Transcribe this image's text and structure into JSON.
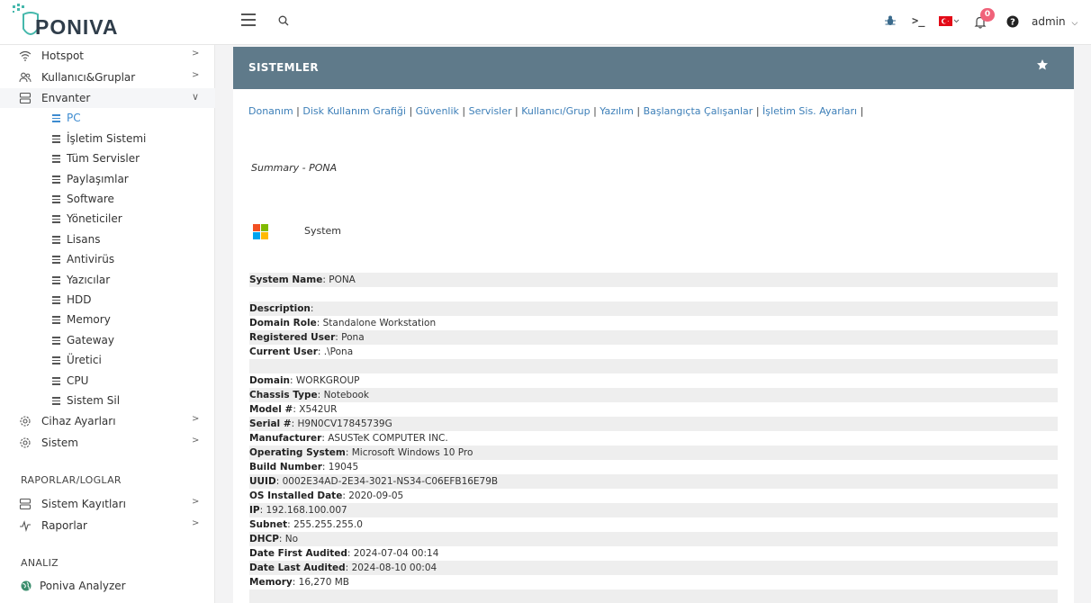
{
  "header": {
    "logo_text": "PONIVA",
    "notification_count": "0",
    "user": "admin"
  },
  "sidebar": {
    "items_top": [
      {
        "label": "Hotspot",
        "icon": "wifi-icon"
      },
      {
        "label": "Kullanıcı&Gruplar",
        "icon": "users-icon"
      },
      {
        "label": "Envanter",
        "icon": "server-icon"
      }
    ],
    "sub_items": [
      {
        "label": "PC"
      },
      {
        "label": "İşletim Sistemi"
      },
      {
        "label": "Tüm Servisler"
      },
      {
        "label": "Paylaşımlar"
      },
      {
        "label": "Software"
      },
      {
        "label": "Yöneticiler"
      },
      {
        "label": "Lisans"
      },
      {
        "label": "Antivirüs"
      },
      {
        "label": "Yazıcılar"
      },
      {
        "label": "HDD"
      },
      {
        "label": "Memory"
      },
      {
        "label": "Gateway"
      },
      {
        "label": "Üretici"
      },
      {
        "label": "CPU"
      },
      {
        "label": "Sistem Sil"
      }
    ],
    "items_bottom": [
      {
        "label": "Cihaz Ayarları",
        "icon": "gear-icon"
      },
      {
        "label": "Sistem",
        "icon": "gear-icon"
      }
    ],
    "section_reports": "RAPORLAR/LOGLAR",
    "reports": [
      {
        "label": "Sistem Kayıtları",
        "icon": "server-icon"
      },
      {
        "label": "Raporlar",
        "icon": "activity-icon"
      }
    ],
    "section_analysis": "ANALIZ",
    "analysis": [
      {
        "label": "Poniva Analyzer",
        "icon": "globe-icon"
      }
    ]
  },
  "panel": {
    "title": "SISTEMLER",
    "tabs": [
      "Donanım",
      "Disk Kullanım Grafiği",
      "Güvenlik",
      "Servisler",
      "Kullanıcı/Grup",
      "Yazılım",
      "Başlangıçta Çalışanlar",
      "İşletim Sis. Ayarları"
    ],
    "summary": "Summary - PONA",
    "system_label": "System",
    "rows": [
      {
        "k": "System Name",
        "v": "PONA",
        "shade": true
      },
      {
        "k": "",
        "v": "",
        "shade": false
      },
      {
        "k": "Description",
        "v": "",
        "shade": true
      },
      {
        "k": "Domain Role",
        "v": "Standalone Workstation",
        "shade": false
      },
      {
        "k": "Registered User",
        "v": "Pona",
        "shade": true
      },
      {
        "k": "Current User",
        "v": ".\\Pona",
        "shade": false
      },
      {
        "k": "",
        "v": "",
        "shade": true
      },
      {
        "k": "Domain",
        "v": "WORKGROUP",
        "shade": false
      },
      {
        "k": "Chassis Type",
        "v": "Notebook",
        "shade": true
      },
      {
        "k": "Model #",
        "v": "X542UR",
        "shade": false
      },
      {
        "k": "Serial #",
        "v": "H9N0CV17845739G",
        "shade": true
      },
      {
        "k": "Manufacturer",
        "v": "ASUSTeK COMPUTER INC.",
        "shade": false
      },
      {
        "k": "Operating System",
        "v": "Microsoft Windows 10 Pro",
        "shade": true
      },
      {
        "k": "Build Number",
        "v": "19045",
        "shade": false
      },
      {
        "k": "UUID",
        "v": "0002E34AD-2E34-3021-NS34-C06EFB16E79B",
        "shade": true
      },
      {
        "k": "OS Installed Date",
        "v": "2020-09-05",
        "shade": false
      },
      {
        "k": "IP",
        "v": "192.168.100.007",
        "shade": true
      },
      {
        "k": "Subnet",
        "v": "255.255.255.0",
        "shade": false
      },
      {
        "k": "DHCP",
        "v": "No",
        "shade": true
      },
      {
        "k": "Date First Audited",
        "v": "2024-07-04   00:14",
        "shade": false
      },
      {
        "k": "Date Last Audited",
        "v": "2024-08-10   00:04",
        "shade": true
      },
      {
        "k": "Memory",
        "v": "16,270 MB",
        "shade": false
      },
      {
        "k": "",
        "v": "",
        "shade": true
      }
    ]
  }
}
